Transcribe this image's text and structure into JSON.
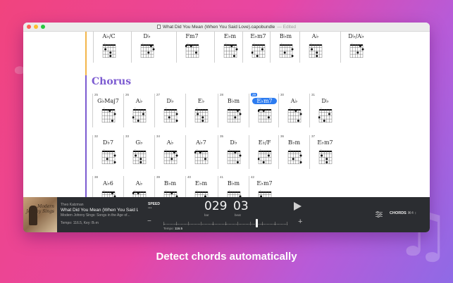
{
  "window": {
    "title": "What Did You Mean (When You Said Love).capobundle",
    "status": "— Edited"
  },
  "sheet": {
    "section_title": "Chorus",
    "top_row": [
      "A♭/C",
      "D♭",
      "Fm7",
      "E♭m",
      "E♭m7",
      "B♭m",
      "A♭",
      "D♭/A♭"
    ],
    "rows": [
      [
        {
          "num": "25",
          "name": "G♭Maj7"
        },
        {
          "num": "26",
          "name": "A♭"
        },
        {
          "num": "27",
          "name": "D♭"
        },
        {
          "num": "",
          "name": "E♭"
        },
        {
          "num": "28",
          "name": "B♭m"
        },
        {
          "num": "29",
          "name": "E♭m7",
          "current": true
        },
        {
          "num": "30",
          "name": "A♭"
        },
        {
          "num": "31",
          "name": "D♭"
        }
      ],
      [
        {
          "num": "32",
          "name": "D♭7"
        },
        {
          "num": "33",
          "name": "G♭"
        },
        {
          "num": "34",
          "name": "A♭"
        },
        {
          "num": "",
          "name": "A♭7"
        },
        {
          "num": "35",
          "name": "D♭"
        },
        {
          "num": "",
          "name": "E♭/F"
        },
        {
          "num": "36",
          "name": "B♭m"
        },
        {
          "num": "37",
          "name": "E♭m7"
        }
      ],
      [
        {
          "num": "38",
          "name": "A♭6"
        },
        {
          "num": "",
          "name": "A♭"
        },
        {
          "num": "39",
          "name": "B♭m"
        },
        {
          "num": "40",
          "name": "E♭m"
        },
        {
          "num": "41",
          "name": "B♭m"
        },
        {
          "num": "42",
          "name": "E♭m7"
        }
      ]
    ]
  },
  "player": {
    "artist": "Theo Katzman",
    "track_title": "What Did You Mean (When You Said L...",
    "album": "Modern Johnny Sings: Songs in the Age of...",
    "tempo_key": "Tempo: 116.5, Key: B♭m",
    "speed_label": "SPEED",
    "speed_dots": "●●●",
    "bar": "029",
    "bar_caption": "bar",
    "beat": "03",
    "beat_caption": "beat",
    "tempo_label": "Tempo:",
    "tempo_value": "116.5",
    "tempo_fraction": 0.75,
    "minus": "−",
    "plus": "+",
    "view_label": "CHORDS",
    "view_shortcut": "⌘4 ↕",
    "album_art_text": "Modern Johnny Sings"
  },
  "caption": "Detect chords automatically",
  "colors": {
    "accent": "#2d7cf0",
    "section_purple": "#7c5bd1",
    "section_orange": "#f3b64a",
    "player_bg": "#2b2d31"
  }
}
